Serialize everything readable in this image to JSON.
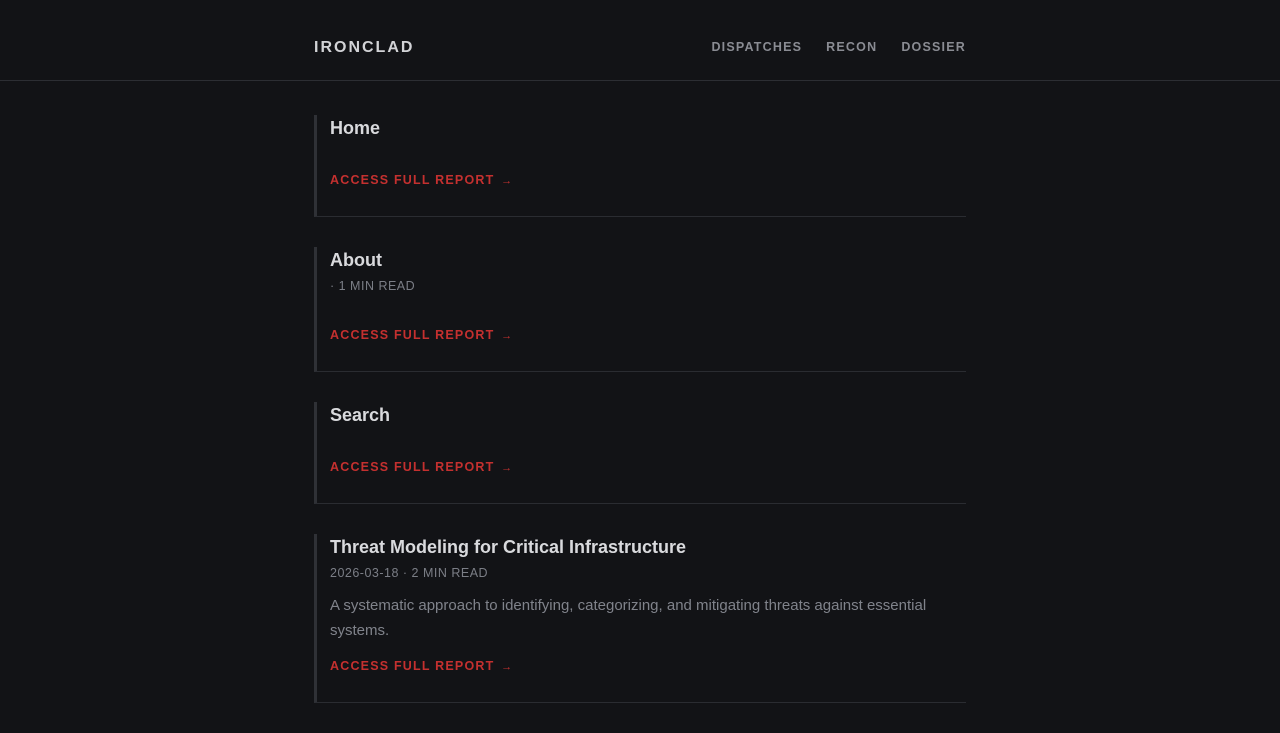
{
  "header": {
    "logo": "IRONCLAD",
    "nav": [
      {
        "label": "DISPATCHES"
      },
      {
        "label": "RECON"
      },
      {
        "label": "DOSSIER"
      }
    ]
  },
  "posts": [
    {
      "title": "Home",
      "meta": "",
      "summary": "",
      "link_label": "ACCESS FULL REPORT",
      "link_arrow": "→"
    },
    {
      "title": "About",
      "meta": "· 1 MIN READ",
      "summary": "",
      "link_label": "ACCESS FULL REPORT",
      "link_arrow": "→"
    },
    {
      "title": "Search",
      "meta": "",
      "summary": "",
      "link_label": "ACCESS FULL REPORT",
      "link_arrow": "→"
    },
    {
      "title": "Threat Modeling for Critical Infrastructure",
      "meta": "2026-03-18 · 2 MIN READ",
      "summary": "A systematic approach to identifying, categorizing, and mitigating threats against essential systems.",
      "link_label": "ACCESS FULL REPORT",
      "link_arrow": "→"
    }
  ],
  "colors": {
    "background": "#121316",
    "accent": "#c4302f",
    "text": "#d9dadd",
    "muted": "#7b7e86"
  }
}
